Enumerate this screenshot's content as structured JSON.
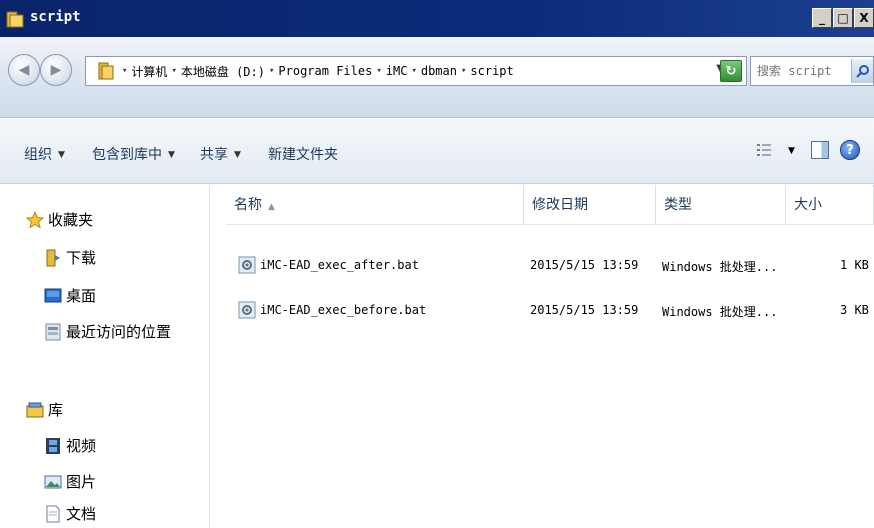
{
  "window": {
    "title": "script",
    "buttons": {
      "minimize": "_",
      "maximize": "□",
      "close": "X"
    }
  },
  "address": {
    "crumbs": [
      "计算机",
      "本地磁盘 (D:)",
      "Program Files",
      "iMC",
      "dbman",
      "script"
    ],
    "search_placeholder": "搜索 script"
  },
  "toolbar": {
    "organize": "组织",
    "include_in_library": "包含到库中",
    "share": "共享",
    "new_folder": "新建文件夹"
  },
  "nav": {
    "favorites": "收藏夹",
    "downloads": "下载",
    "desktop": "桌面",
    "recent": "最近访问的位置",
    "libraries": "库",
    "videos": "视频",
    "pictures": "图片",
    "documents": "文档"
  },
  "columns": {
    "name": "名称",
    "date": "修改日期",
    "type": "类型",
    "size": "大小"
  },
  "files": [
    {
      "name": "iMC-EAD_exec_after.bat",
      "date": "2015/5/15 13:59",
      "type": "Windows 批处理...",
      "size": "1 KB"
    },
    {
      "name": "iMC-EAD_exec_before.bat",
      "date": "2015/5/15 13:59",
      "type": "Windows 批处理...",
      "size": "3 KB"
    }
  ],
  "colors": {
    "titlebar": "#0a246a",
    "link_text": "#1e395b"
  }
}
